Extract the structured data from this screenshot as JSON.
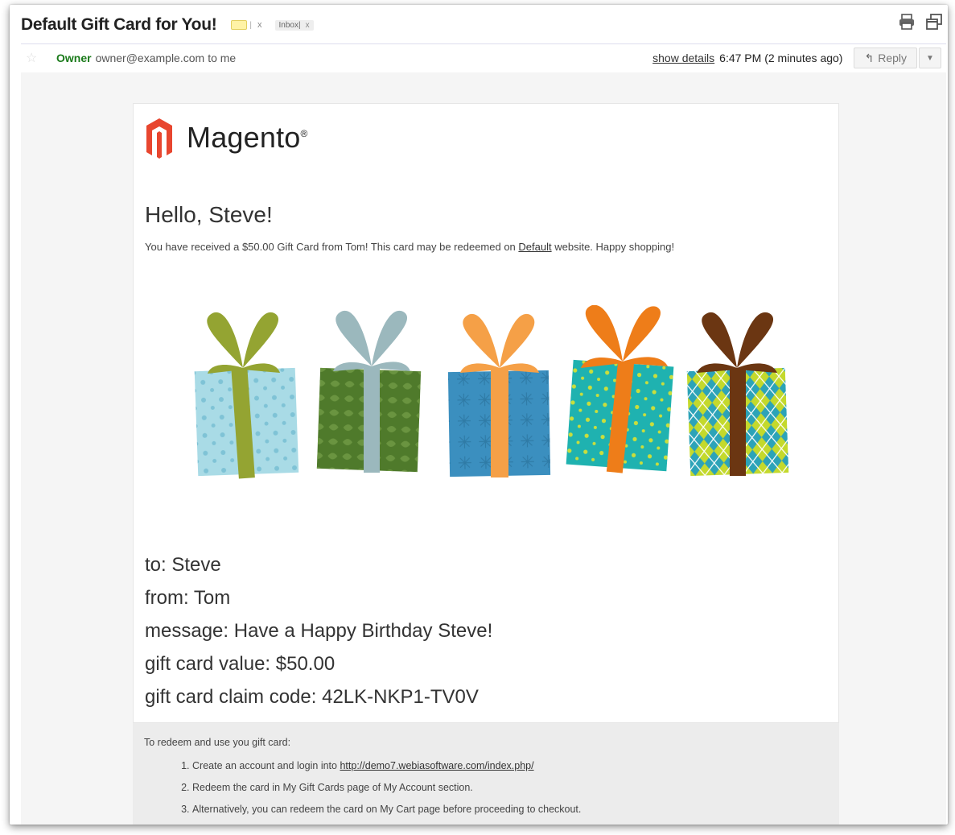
{
  "header": {
    "subject": "Default Gift Card for You!",
    "label_remove": "x",
    "inbox_label": "Inbox",
    "inbox_remove": "x",
    "print_icon": "printer-icon",
    "new_window_icon": "new-window-icon"
  },
  "sender": {
    "name": "Owner",
    "email": "owner@example.com",
    "to": "to me",
    "show_details": "show details",
    "time": "6:47 PM (2 minutes ago)",
    "reply_label": "Reply",
    "more_symbol": "▼"
  },
  "email": {
    "brand": "Magento",
    "brand_mark": "®",
    "greeting": "Hello, Steve!",
    "intro_before_link": "You have received a $50.00 Gift Card from Tom! This card may be redeemed on ",
    "intro_link": "Default",
    "intro_after_link": " website. Happy shopping!",
    "details": [
      {
        "label": "to:",
        "value": "Steve"
      },
      {
        "label": "from:",
        "value": "Tom"
      },
      {
        "label": "message:",
        "value": "Have a Happy Birthday Steve!"
      },
      {
        "label": "gift card value:",
        "value": "$50.00"
      },
      {
        "label": "gift card claim code:",
        "value": "42LK-NKP1-TV0V"
      }
    ],
    "redeem": {
      "lead": "To redeem and use you gift card:",
      "step1_text": "Create an account and login into ",
      "step1_link": "http://demo7.webiasoftware.com/index.php/",
      "step2": "Redeem the card in My Gift Cards page of My Account section.",
      "step3": "Alternatively, you can redeem the card on My Cart page before proceeding to checkout."
    }
  },
  "colors": {
    "sender_green": "#1a7a1a",
    "magento_red": "#e8462f",
    "gift_olive": "#94a432",
    "gift_sky": "#a9dbe6",
    "gift_green": "#4f7a2b",
    "gift_grey_blue": "#9bb8bd",
    "gift_blue": "#3b8fbf",
    "gift_orange": "#f5a047",
    "gift_teal": "#1fb2b0",
    "gift_dark_orange": "#ee7d19",
    "gift_brown": "#6b3612",
    "gift_lime": "#c4d92c"
  }
}
